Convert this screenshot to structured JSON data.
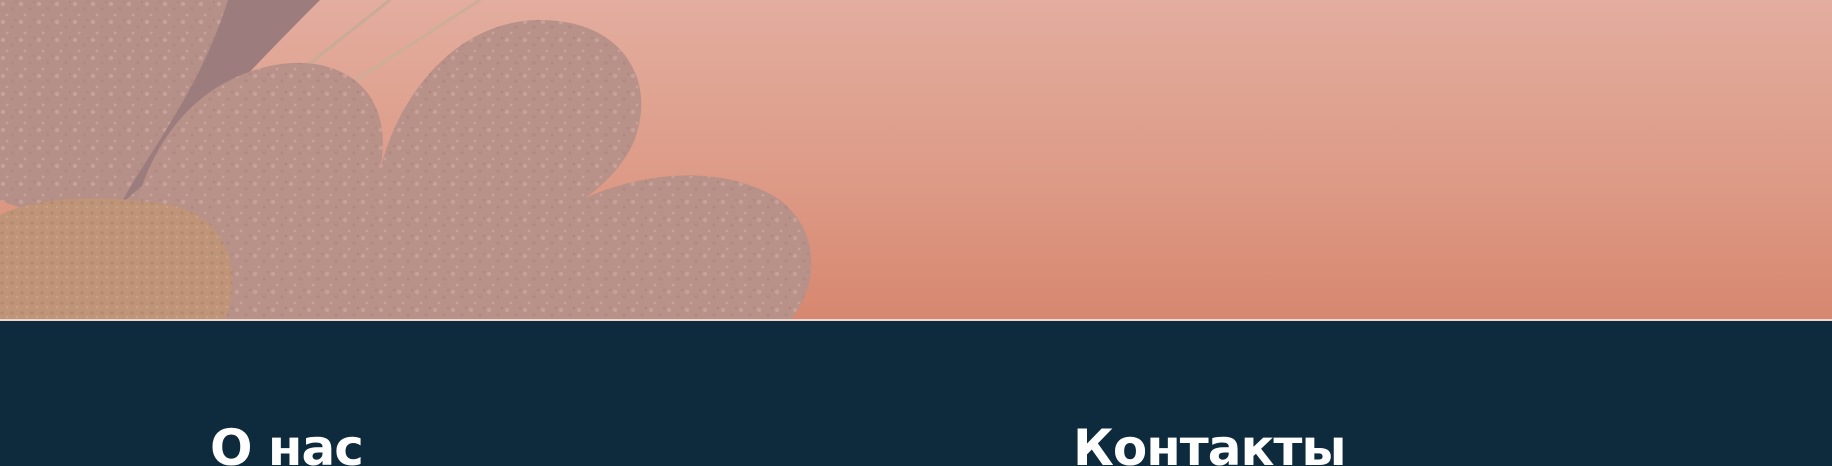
{
  "footer": {
    "about_title": "О нас",
    "contacts_title": "Контакты"
  },
  "colors": {
    "hero_top": "#e3ad9f",
    "hero_bottom": "#d7876f",
    "footer_bg": "#0e2a3d",
    "heading_text": "#ffffff",
    "flower_petals": "#b89189",
    "flower_center": "#bf9478"
  }
}
